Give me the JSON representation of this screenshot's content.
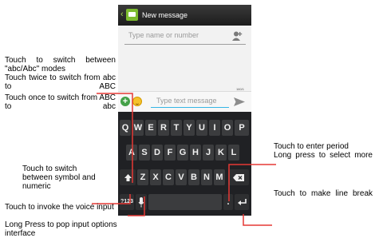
{
  "app": {
    "title": "New message"
  },
  "recipient": {
    "placeholder": "Type name or number"
  },
  "compose": {
    "placeholder": "Type text message",
    "counter": "160/1"
  },
  "keyboard": {
    "row1": [
      "Q",
      "W",
      "E",
      "R",
      "T",
      "Y",
      "U",
      "I",
      "O",
      "P"
    ],
    "row2": [
      "A",
      "S",
      "D",
      "F",
      "G",
      "H",
      "J",
      "K",
      "L"
    ],
    "row3": [
      "Z",
      "X",
      "C",
      "V",
      "B",
      "N",
      "M"
    ],
    "symbols_key": "?123",
    "period_key": "."
  },
  "annotations": {
    "case_switch": "Touch to switch between \"abc/Abc\" modes",
    "caps_abc": "Touch twice to switch from abc to ABC",
    "caps_once": "Touch once to switch from ABC to abc",
    "period": "Touch to enter period",
    "period_long": "Long press to select more",
    "symbol": "Touch to switch between symbol and numeric",
    "line_break": "Touch to make line break",
    "voice": "Touch to invoke the voice input",
    "voice_long": "Long Press to pop input options interface"
  },
  "colors": {
    "accent": "#35b5e5",
    "leader_line": "#e53935",
    "titlebar": "#2a2a2a",
    "keyboard_bg": "#202124"
  }
}
